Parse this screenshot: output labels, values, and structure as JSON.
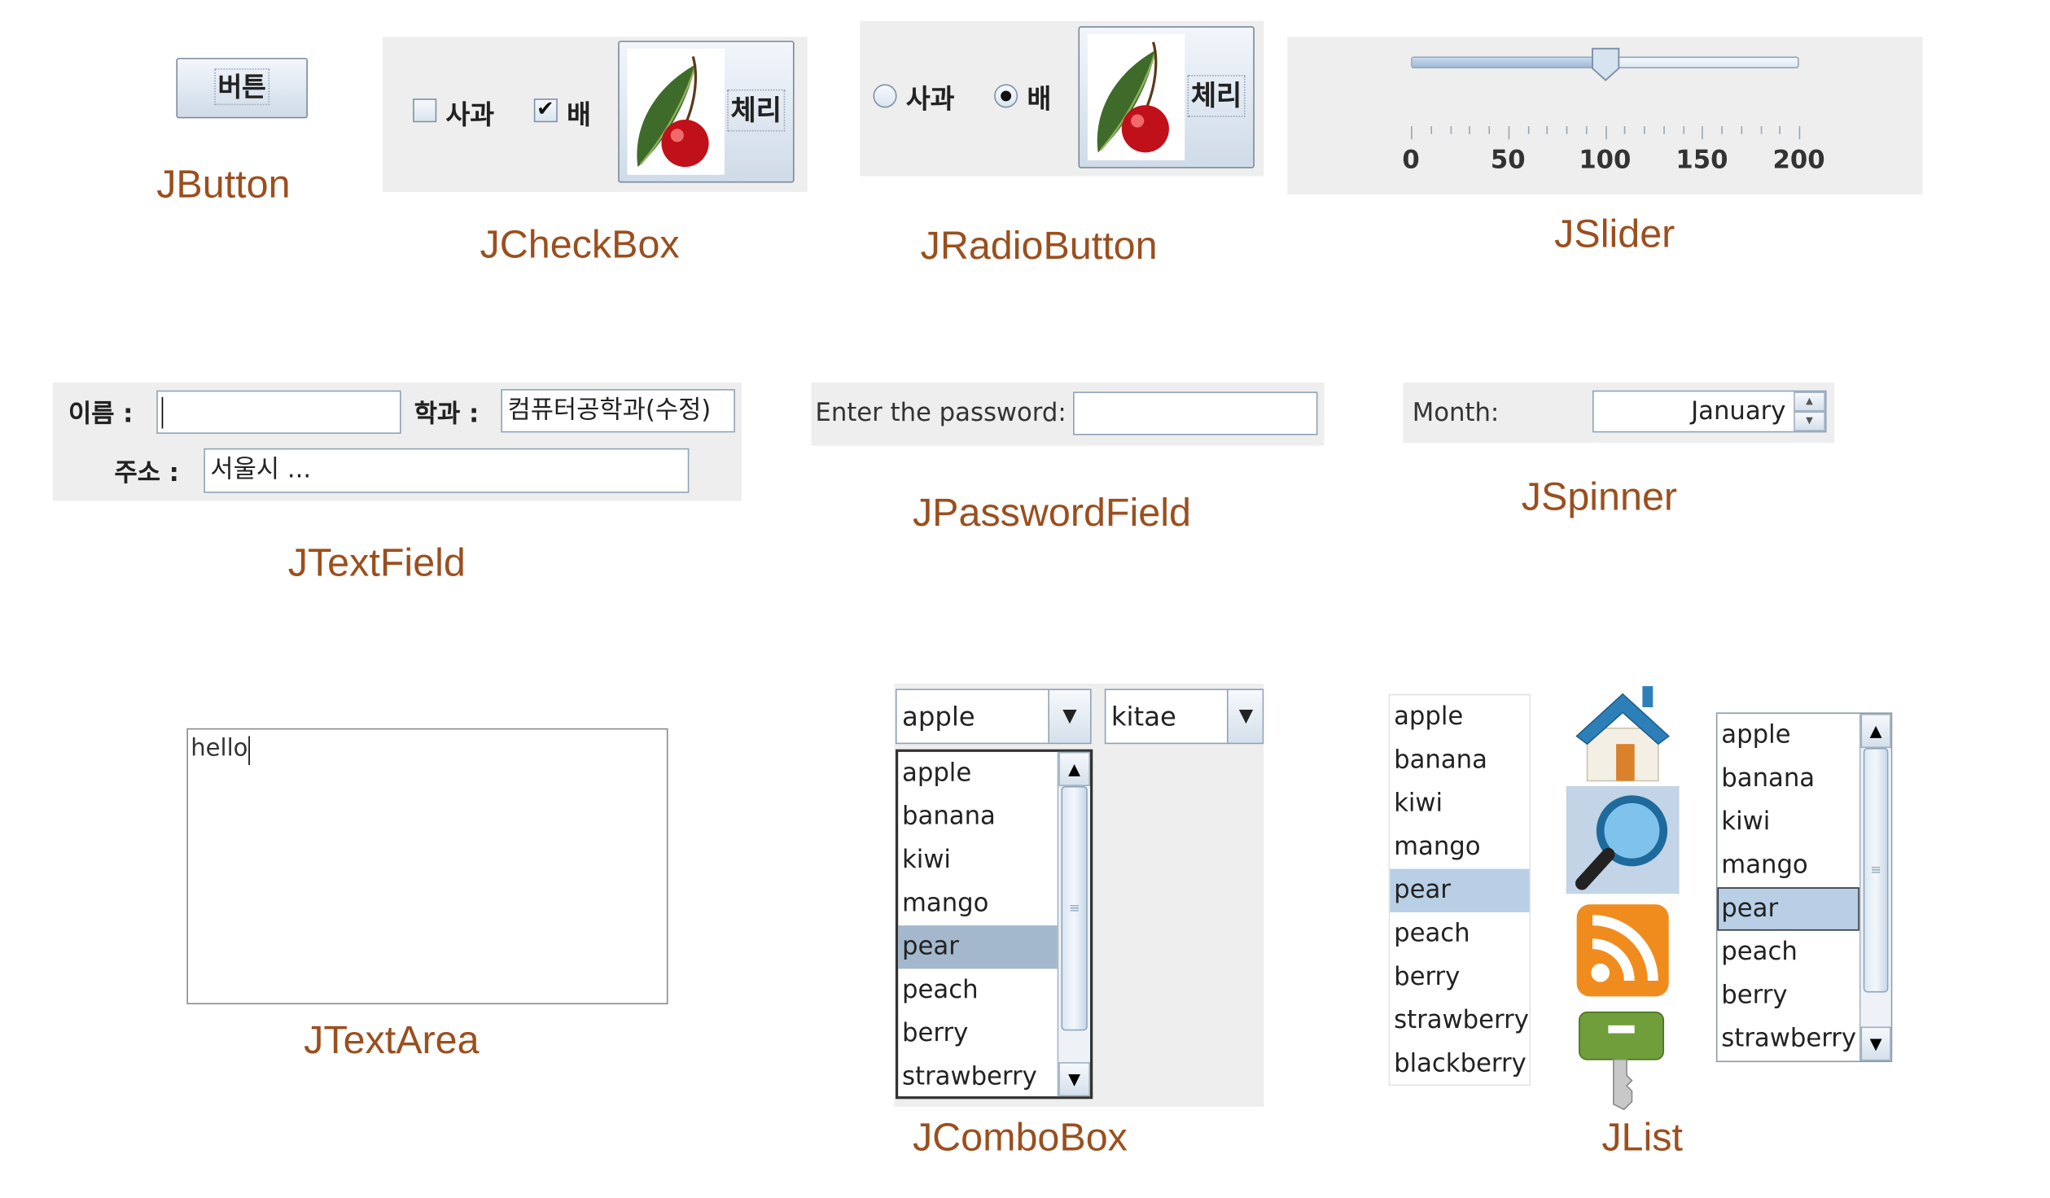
{
  "jbutton": {
    "label": "버튼",
    "caption": "JButton"
  },
  "jcheckbox": {
    "apple": "사과",
    "pear": "배",
    "cherry": "체리",
    "caption": "JCheckBox"
  },
  "jradiobutton": {
    "apple": "사과",
    "pear": "배",
    "cherry": "체리",
    "caption": "JRadioButton"
  },
  "jslider": {
    "value": 100,
    "min": 0,
    "max": 200,
    "ticks": [
      "0",
      "50",
      "100",
      "150",
      "200"
    ],
    "caption": "JSlider"
  },
  "jtextfield": {
    "name_label": "이름 :",
    "name_value": "",
    "dept_label": "학과 :",
    "dept_value": "컴퓨터공학과(수정)",
    "addr_label": "주소 :",
    "addr_value": "서울시 ...",
    "caption": "JTextField"
  },
  "jpasswordfield": {
    "label": "Enter the password:",
    "value": "",
    "caption": "JPasswordField"
  },
  "jspinner": {
    "label": "Month:",
    "value": "January",
    "up": "▲",
    "down": "▼",
    "caption": "JSpinner"
  },
  "jtextarea": {
    "text": "hello",
    "caption": "JTextArea"
  },
  "jcombobox": {
    "selected": "apple",
    "second_value": "kitae",
    "arrow": "▼",
    "items": [
      "apple",
      "banana",
      "kiwi",
      "mango",
      "pear",
      "peach",
      "berry",
      "strawberry"
    ],
    "highlighted": "pear",
    "caption": "JComboBox"
  },
  "jlist": {
    "items": [
      "apple",
      "banana",
      "kiwi",
      "mango",
      "pear",
      "peach",
      "berry",
      "strawberry",
      "blackberry"
    ],
    "scroll_items": [
      "apple",
      "banana",
      "kiwi",
      "mango",
      "pear",
      "peach",
      "berry",
      "strawberry"
    ],
    "selected": "pear",
    "icons": [
      "home-icon",
      "search-icon",
      "rss-icon",
      "key-icon"
    ],
    "caption": "JList"
  },
  "colors": {
    "caption": "#9b4f1e",
    "panel": "#eeeeee",
    "selection": "#b8cfe5"
  }
}
